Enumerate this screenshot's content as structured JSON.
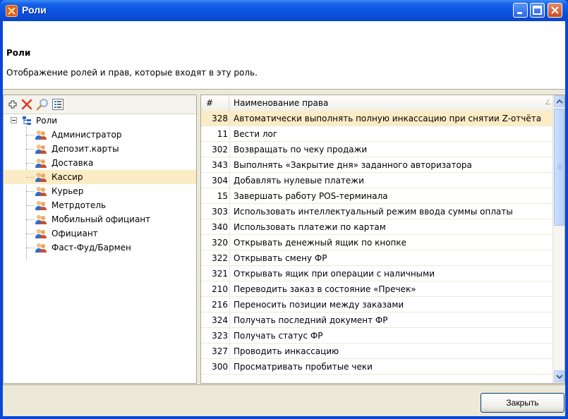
{
  "window": {
    "title": "Роли",
    "accent": "#0a46d8"
  },
  "header": {
    "title": "Роли",
    "description": "Отображение ролей и прав, которые входят в эту роль."
  },
  "toolbar": {
    "icons": [
      "add-icon",
      "delete-icon",
      "search-icon",
      "properties-icon"
    ]
  },
  "tree": {
    "root": "Роли",
    "items": [
      {
        "label": "Администратор",
        "selected": false
      },
      {
        "label": "Депозит.карты",
        "selected": false
      },
      {
        "label": "Доставка",
        "selected": false
      },
      {
        "label": "Кассир",
        "selected": true
      },
      {
        "label": "Курьер",
        "selected": false
      },
      {
        "label": "Метрдотель",
        "selected": false
      },
      {
        "label": "Мобильный официант",
        "selected": false
      },
      {
        "label": "Официант",
        "selected": false
      },
      {
        "label": "Фаст-Фуд/Бармен",
        "selected": false
      }
    ]
  },
  "grid": {
    "columns": [
      "#",
      "Наименование права"
    ],
    "sort_glyph": "∠",
    "rows": [
      {
        "num": "328",
        "name": "Автоматически выполнять полную инкассацию при снятии Z-отчёта",
        "selected": true
      },
      {
        "num": "11",
        "name": "Вести лог"
      },
      {
        "num": "302",
        "name": "Возвращать по чеку продажи"
      },
      {
        "num": "343",
        "name": "Выполнять «Закрытие дня» заданного авторизатора"
      },
      {
        "num": "304",
        "name": "Добавлять нулевые платежи"
      },
      {
        "num": "15",
        "name": "Завершать работу POS-терминала"
      },
      {
        "num": "303",
        "name": "Использовать интеллектуальный режим ввода суммы оплаты"
      },
      {
        "num": "340",
        "name": "Использовать платежи по картам"
      },
      {
        "num": "320",
        "name": "Открывать денежный ящик по кнопке"
      },
      {
        "num": "322",
        "name": "Открывать смену ФР"
      },
      {
        "num": "321",
        "name": "Открывать ящик при операции с наличными"
      },
      {
        "num": "210",
        "name": "Переводить заказ в состояние «Пречек»"
      },
      {
        "num": "216",
        "name": "Переносить позиции между заказами"
      },
      {
        "num": "324",
        "name": "Получать последний документ ФР"
      },
      {
        "num": "323",
        "name": "Получать статус ФР"
      },
      {
        "num": "327",
        "name": "Проводить инкассацию"
      },
      {
        "num": "300",
        "name": "Просматривать пробитые чеки"
      }
    ]
  },
  "footer": {
    "close_label": "Закрыть"
  }
}
